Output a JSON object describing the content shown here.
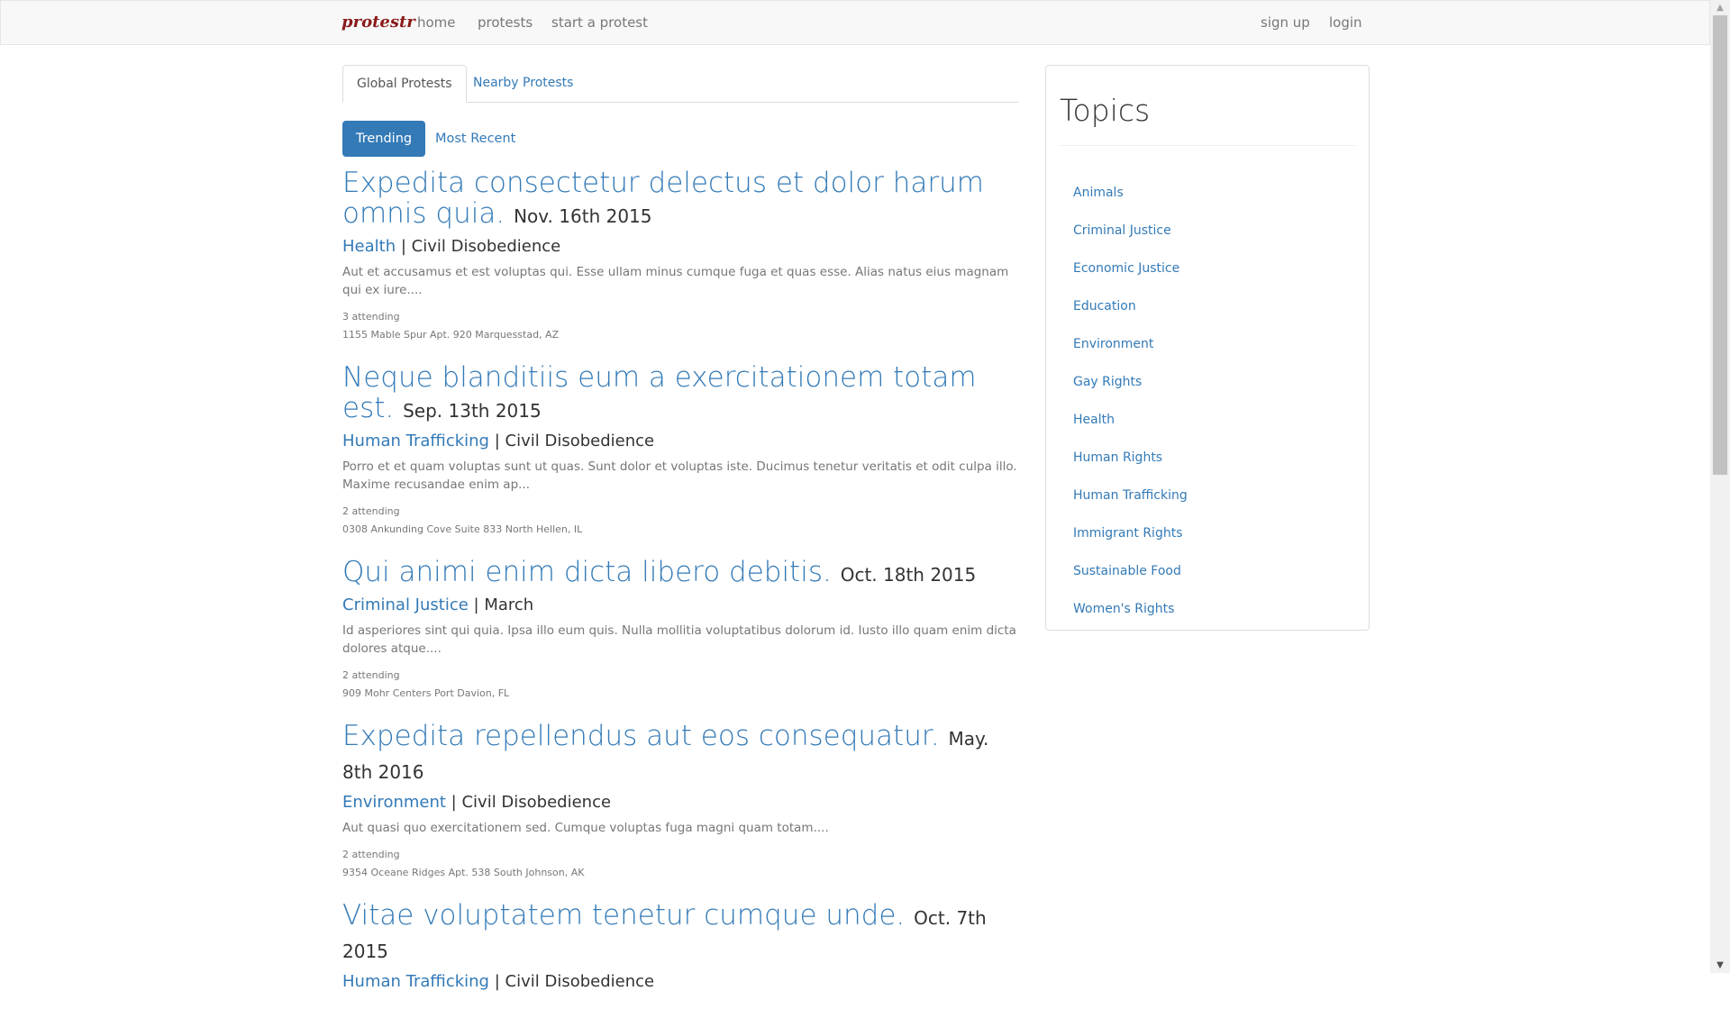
{
  "navbar": {
    "brand": "protestr",
    "links": [
      "home",
      "protests",
      "start a protest"
    ],
    "right_links": [
      "sign up",
      "login"
    ]
  },
  "tabs": [
    "Global Protests",
    "Nearby Protests"
  ],
  "sort_pills": [
    "Trending",
    "Most Recent"
  ],
  "protests": [
    {
      "title": "Expedita consectetur delectus et dolor harum omnis quia.",
      "date": "Nov. 16th 2015",
      "topic": "Health",
      "kind": "Civil Disobedience",
      "description": "Aut et accusamus et est voluptas qui. Esse ullam minus cumque fuga et quas esse. Alias natus eius magnam qui ex iure....",
      "attending": "3 attending",
      "address": "1155 Mable Spur Apt. 920 Marquesstad, AZ"
    },
    {
      "title": "Neque blanditiis eum a exercitationem totam est.",
      "date": "Sep. 13th 2015",
      "topic": "Human Trafficking",
      "kind": "Civil Disobedience",
      "description": "Porro et et quam voluptas sunt ut quas. Sunt dolor et voluptas iste. Ducimus tenetur veritatis et odit culpa illo. Maxime recusandae enim ap...",
      "attending": "2 attending",
      "address": "0308 Ankunding Cove Suite 833 North Hellen, IL"
    },
    {
      "title": "Qui animi enim dicta libero debitis.",
      "date": "Oct. 18th 2015",
      "topic": "Criminal Justice",
      "kind": "March",
      "description": "Id asperiores sint qui quia. Ipsa illo eum quis. Nulla mollitia voluptatibus dolorum id. Iusto illo quam enim dicta dolores atque....",
      "attending": "2 attending",
      "address": "909 Mohr Centers Port Davion, FL"
    },
    {
      "title": "Expedita repellendus aut eos consequatur.",
      "date": "May. 8th 2016",
      "topic": "Environment",
      "kind": "Civil Disobedience",
      "description": "Aut quasi quo exercitationem sed. Cumque voluptas fuga magni quam totam....",
      "attending": "2 attending",
      "address": "9354 Oceane Ridges Apt. 538 South Johnson, AK"
    },
    {
      "title": "Vitae voluptatem tenetur cumque unde.",
      "date": "Oct. 7th 2015",
      "topic": "Human Trafficking",
      "kind": "Civil Disobedience",
      "description": "",
      "attending": "",
      "address": ""
    }
  ],
  "topics_panel": {
    "title": "Topics",
    "items": [
      "Animals",
      "Criminal Justice",
      "Economic Justice",
      "Education",
      "Environment",
      "Gay Rights",
      "Health",
      "Human Rights",
      "Human Trafficking",
      "Immigrant Rights",
      "Sustainable Food",
      "Women's Rights"
    ]
  }
}
